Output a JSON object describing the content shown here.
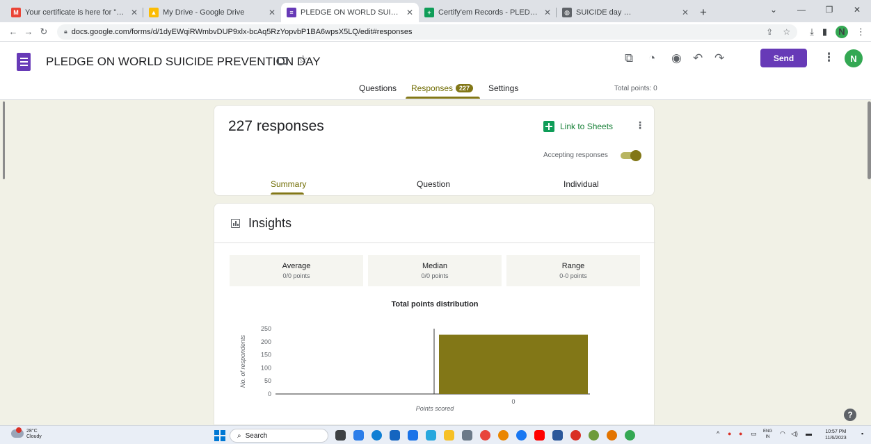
{
  "browser": {
    "tabs": [
      {
        "title": "Your certificate is here for \"PLEDGE",
        "favicon": "gmail-icon",
        "color": "#ea4335"
      },
      {
        "title": "My Drive - Google Drive",
        "favicon": "drive-icon",
        "color": "#fbbc04"
      },
      {
        "title": "PLEDGE ON WORLD SUICIDE PREVENTION",
        "favicon": "forms-icon",
        "color": "#673ab7"
      },
      {
        "title": "Certify'em Records - PLEDGE ON",
        "favicon": "sheets-icon",
        "color": "#0f9d58"
      },
      {
        "title": "SUICIDE day cert",
        "favicon": "globe-icon",
        "color": "#5f6368"
      }
    ],
    "active_tab": 2,
    "url": "docs.google.com/forms/d/1dyEWqiRWmbvDUP9xlx-bcAq5RzYopvbP1BA6wpsX5LQ/edit#responses",
    "profile_initial": "N"
  },
  "form": {
    "title": "PLEDGE ON WORLD SUICIDE PREVENTION DAY",
    "send_label": "Send",
    "avatar_initial": "N",
    "tabs": {
      "questions": "Questions",
      "responses": "Responses",
      "responses_count": "227",
      "settings": "Settings"
    },
    "total_points": "Total points: 0"
  },
  "responses": {
    "count_label": "227 responses",
    "link_to_sheets": "Link to Sheets",
    "accepting_label": "Accepting responses",
    "accepting": true,
    "subtabs": {
      "summary": "Summary",
      "question": "Question",
      "individual": "Individual"
    }
  },
  "insights": {
    "title": "Insights",
    "stats": [
      {
        "label": "Average",
        "value": "0/0 points"
      },
      {
        "label": "Median",
        "value": "0/0 points"
      },
      {
        "label": "Range",
        "value": "0-0 points"
      }
    ]
  },
  "chart_data": {
    "type": "bar",
    "title": "Total points distribution",
    "xlabel": "Points scored",
    "ylabel": "No. of respondents",
    "categories": [
      "0"
    ],
    "values": [
      227
    ],
    "ylim": [
      0,
      250
    ],
    "yticks": [
      0,
      50,
      100,
      150,
      200,
      250
    ],
    "bar_color": "#827717",
    "grid": false
  },
  "taskbar": {
    "temperature": "28°C",
    "weather": "Cloudy",
    "search_label": "Search",
    "lang_top": "ENG",
    "lang_bottom": "IN",
    "time": "10:57 PM",
    "date": "11/6/2023"
  },
  "colors": {
    "accent": "#673ab7",
    "theme": "#827717",
    "sheets": "#188038"
  }
}
